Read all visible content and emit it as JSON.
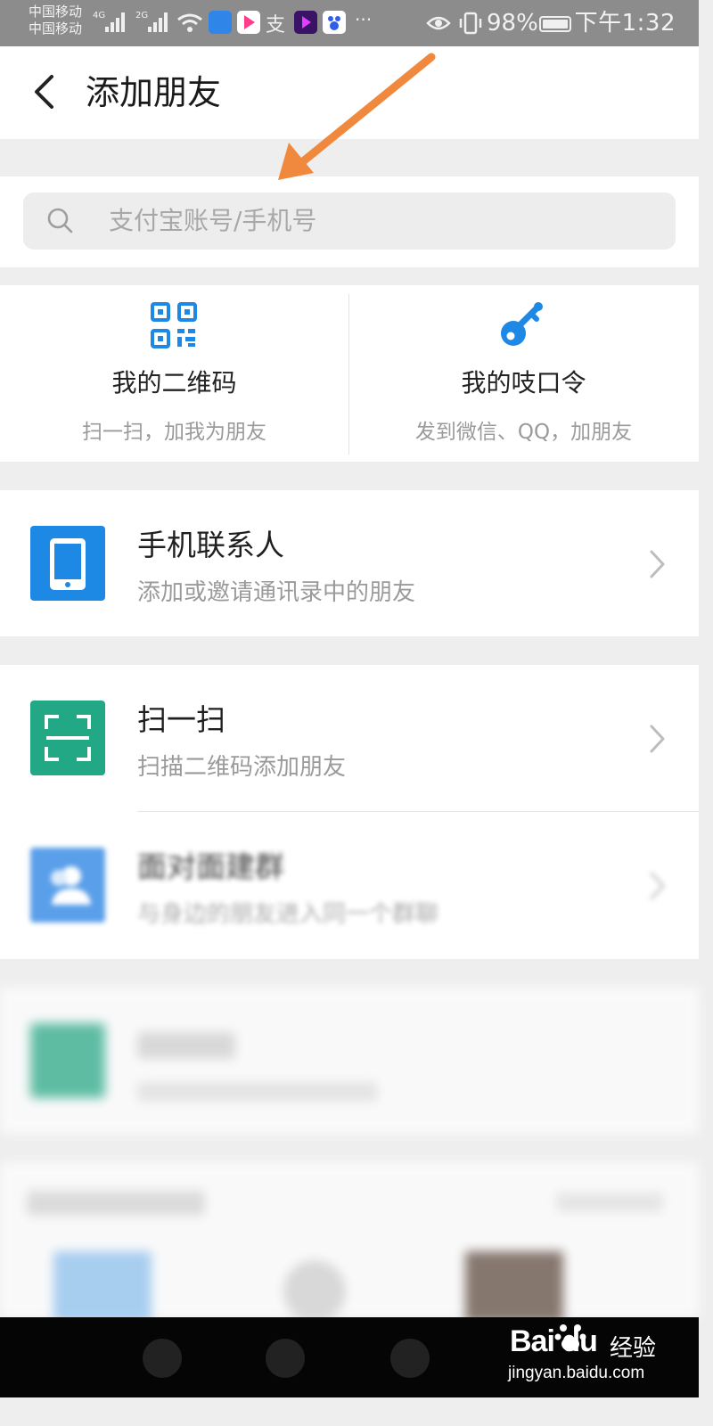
{
  "status_bar": {
    "carrier_1": "中国移动",
    "carrier_2": "中国移动",
    "net_1": "4G",
    "net_2": "2G",
    "battery": "98%",
    "time": "下午1:32"
  },
  "header": {
    "title": "添加朋友"
  },
  "search": {
    "placeholder": "支付宝账号/手机号"
  },
  "quick_actions": [
    {
      "label": "我的二维码",
      "sub": "扫一扫，加我为朋友",
      "icon": "qr-code-icon"
    },
    {
      "label": "我的吱口令",
      "sub": "发到微信、QQ，加朋友",
      "icon": "key-icon"
    }
  ],
  "list": [
    {
      "title": "手机联系人",
      "sub": "添加或邀请通讯录中的朋友",
      "icon": "phone-icon",
      "color": "#1e88e5"
    },
    {
      "title": "扫一扫",
      "sub": "扫描二维码添加朋友",
      "icon": "scan-icon",
      "color": "#22a884"
    },
    {
      "title": "面对面建群",
      "sub": "与身边的朋友进入同一个群聊",
      "icon": "people-icon",
      "color": "#3e8fe6"
    }
  ],
  "watermark": {
    "brand": "Bai du",
    "cn": "经验",
    "url": "jingyan.baidu.com"
  },
  "colors": {
    "accent_blue": "#1e88e5",
    "scan_green": "#22a884",
    "annotation_orange": "#f0883e"
  }
}
